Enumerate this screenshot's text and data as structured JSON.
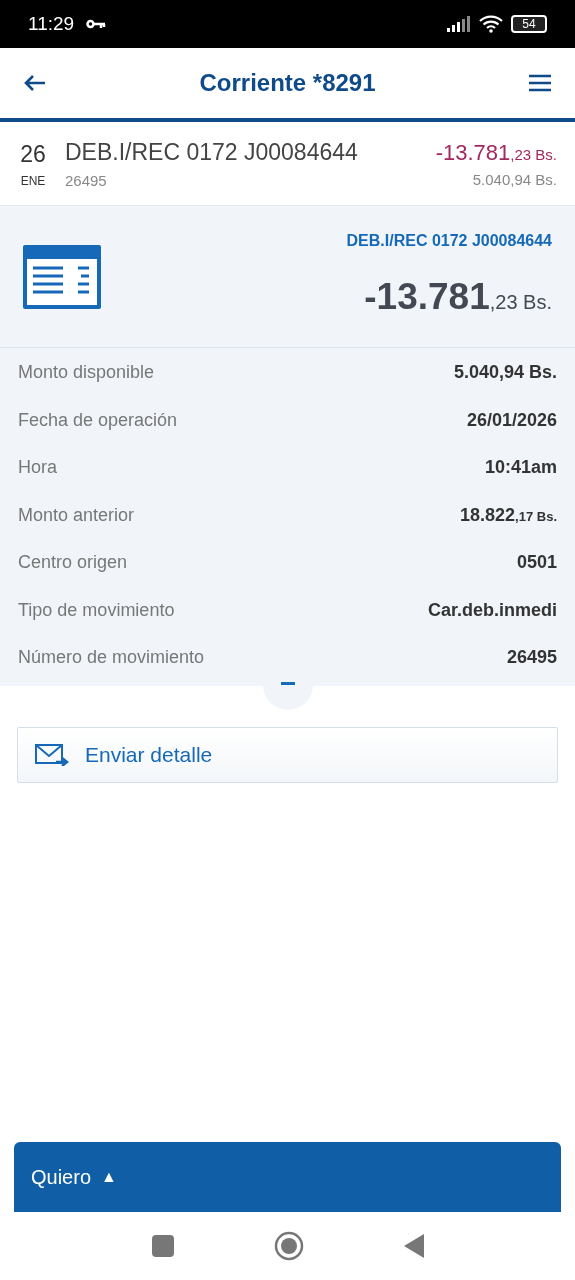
{
  "status_bar": {
    "time": "11:29",
    "battery": "54"
  },
  "header": {
    "title": "Corriente *8291"
  },
  "transaction": {
    "day": "26",
    "month": "ENE",
    "description": "DEB.I/REC 0172 J00084644",
    "reference": "26495",
    "amount": {
      "main": "-13.781",
      "cents": ",23 Bs."
    },
    "balance": "5.040,94 Bs."
  },
  "detail": {
    "title": "DEB.I/REC 0172 J00084644",
    "amount": {
      "main": "-13.781",
      "cents": ",23 Bs."
    },
    "rows": [
      {
        "label": "Monto disponible",
        "value": "5.040,94 Bs."
      },
      {
        "label": "Fecha de operación",
        "value": "26/01/2026"
      },
      {
        "label": "Hora",
        "value": "10:41am"
      },
      {
        "label": "Monto anterior",
        "value": "18.822",
        "cents": ",17 Bs."
      },
      {
        "label": "Centro origen",
        "value": "0501"
      },
      {
        "label": "Tipo de movimiento",
        "value": "Car.deb.inmedi"
      },
      {
        "label": "Número de movimiento",
        "value": "26495"
      }
    ],
    "expanded": true
  },
  "send_button": {
    "label": "Enviar detalle"
  },
  "bottom_bar": {
    "label": "Quiero",
    "caret": "▲"
  }
}
